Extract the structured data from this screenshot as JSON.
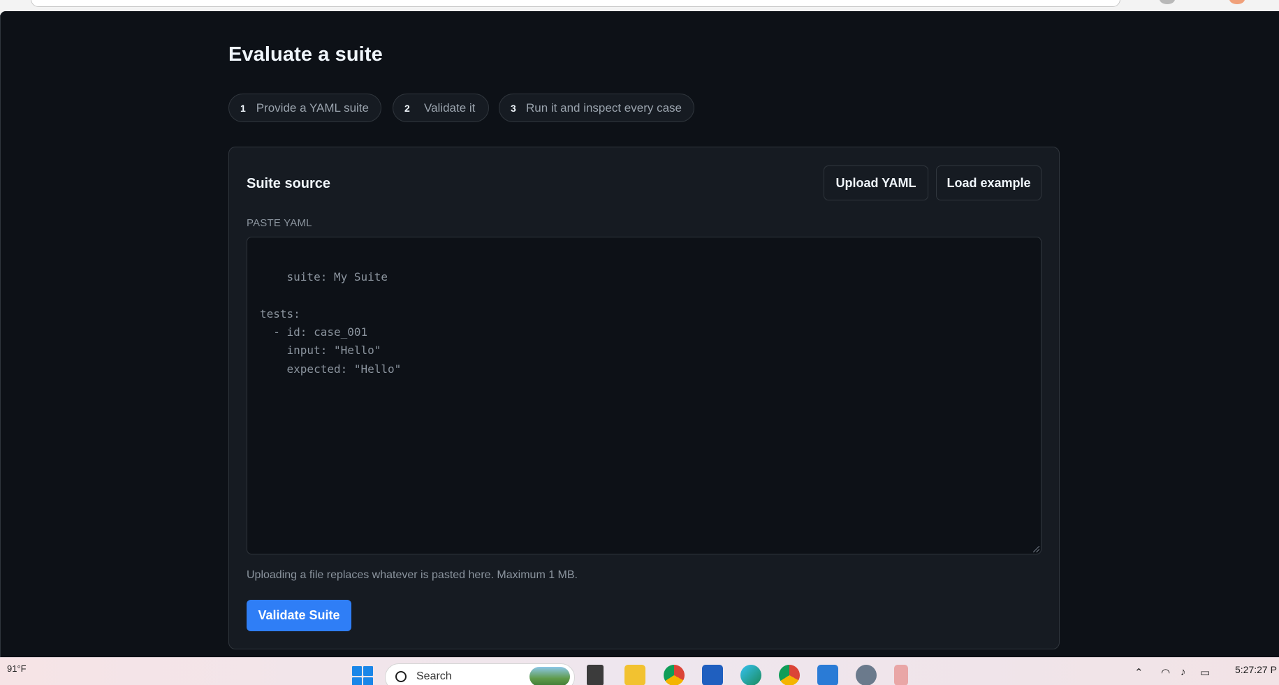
{
  "page": {
    "title": "Evaluate a suite"
  },
  "steps": [
    {
      "number": "1",
      "label": "Provide a YAML suite"
    },
    {
      "number": "2",
      "label": "Validate it"
    },
    {
      "number": "3",
      "label": "Run it and inspect every case"
    }
  ],
  "suite_source": {
    "title": "Suite source",
    "upload_label": "Upload YAML",
    "load_example_label": "Load example",
    "field_label": "PASTE YAML",
    "placeholder": "suite: My Suite\n\ntests:\n  - id: case_001\n    input: \"Hello\"\n    expected: \"Hello\"",
    "hint": "Uploading a file replaces whatever is pasted here. Maximum 1 MB.",
    "validate_label": "Validate Suite"
  },
  "taskbar": {
    "weather_temp": "91°F",
    "search_label": "Search",
    "clock_time": "5:27:27 P",
    "apps": [
      "file-explorer-icon",
      "chrome-icon",
      "store-icon",
      "edge-icon",
      "chrome-profile-icon",
      "vscode-icon",
      "settings-icon"
    ]
  },
  "colors": {
    "background": "#0d1117",
    "card": "#161b22",
    "border": "#30363d",
    "accent": "#2f7ef6"
  }
}
